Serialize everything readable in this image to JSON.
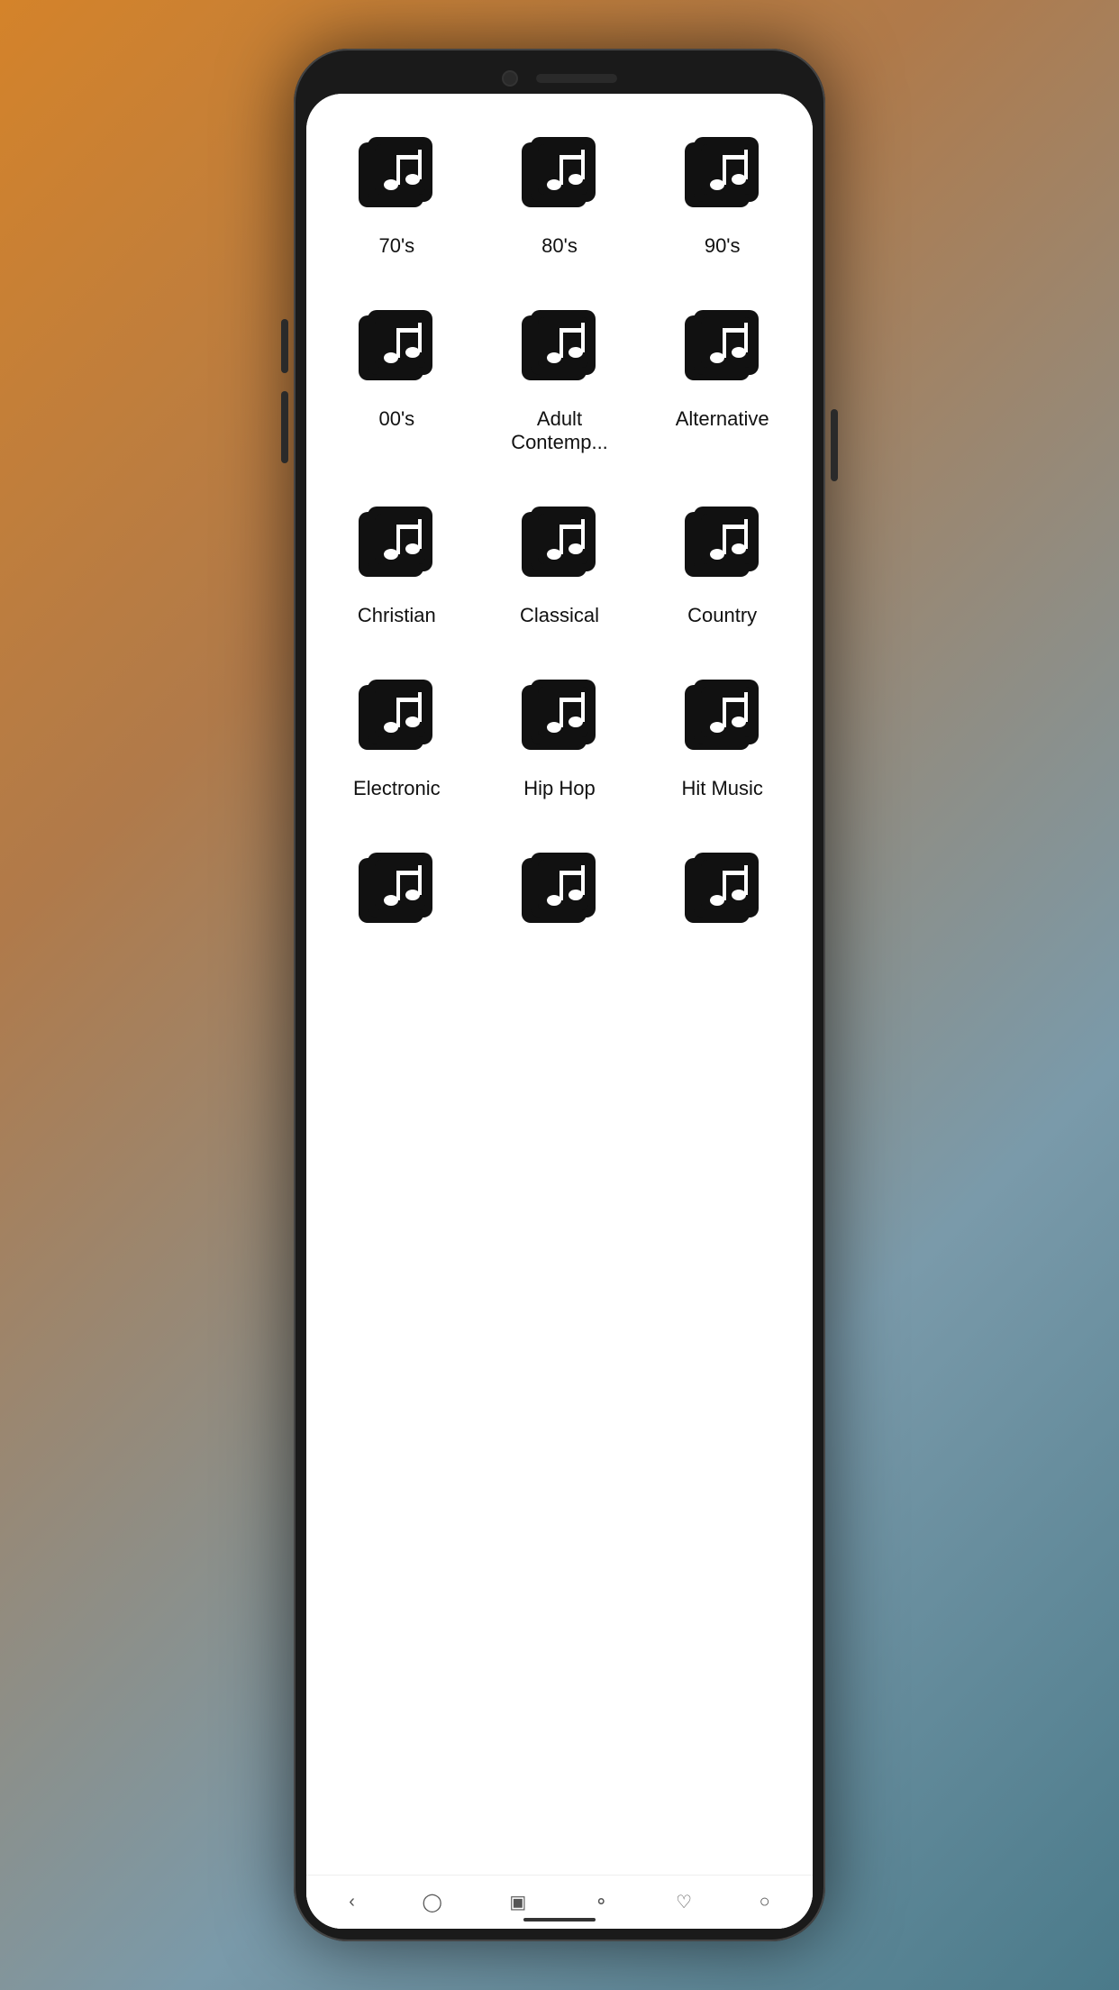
{
  "genres": [
    {
      "id": "70s",
      "label": "70's"
    },
    {
      "id": "80s",
      "label": "80's"
    },
    {
      "id": "90s",
      "label": "90's"
    },
    {
      "id": "00s",
      "label": "00's"
    },
    {
      "id": "adult-contemp",
      "label": "Adult Contemp..."
    },
    {
      "id": "alternative",
      "label": "Alternative"
    },
    {
      "id": "christian",
      "label": "Christian"
    },
    {
      "id": "classical",
      "label": "Classical"
    },
    {
      "id": "country",
      "label": "Country"
    },
    {
      "id": "electronic",
      "label": "Electronic"
    },
    {
      "id": "hip-hop",
      "label": "Hip Hop"
    },
    {
      "id": "hit-music",
      "label": "Hit Music"
    },
    {
      "id": "genre-13",
      "label": ""
    },
    {
      "id": "genre-14",
      "label": ""
    },
    {
      "id": "genre-15",
      "label": ""
    }
  ],
  "nav": {
    "icons": [
      "home",
      "back",
      "menu",
      "search",
      "heart",
      "profile"
    ]
  }
}
